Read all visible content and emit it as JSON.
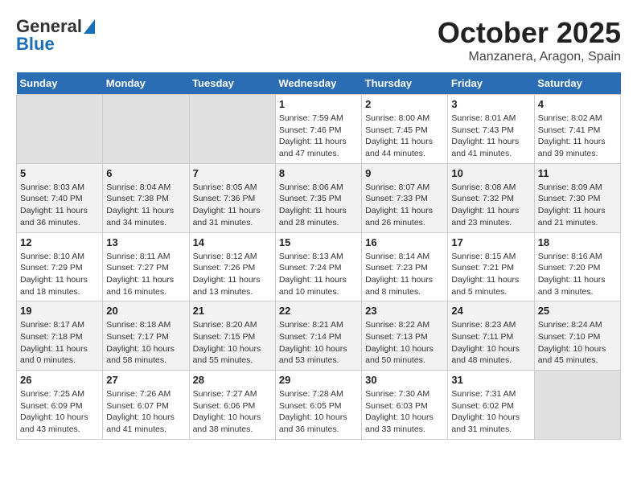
{
  "header": {
    "logo_general": "General",
    "logo_blue": "Blue",
    "month": "October 2025",
    "location": "Manzanera, Aragon, Spain"
  },
  "weekdays": [
    "Sunday",
    "Monday",
    "Tuesday",
    "Wednesday",
    "Thursday",
    "Friday",
    "Saturday"
  ],
  "weeks": [
    [
      {
        "day": "",
        "info": ""
      },
      {
        "day": "",
        "info": ""
      },
      {
        "day": "",
        "info": ""
      },
      {
        "day": "1",
        "info": "Sunrise: 7:59 AM\nSunset: 7:46 PM\nDaylight: 11 hours and 47 minutes."
      },
      {
        "day": "2",
        "info": "Sunrise: 8:00 AM\nSunset: 7:45 PM\nDaylight: 11 hours and 44 minutes."
      },
      {
        "day": "3",
        "info": "Sunrise: 8:01 AM\nSunset: 7:43 PM\nDaylight: 11 hours and 41 minutes."
      },
      {
        "day": "4",
        "info": "Sunrise: 8:02 AM\nSunset: 7:41 PM\nDaylight: 11 hours and 39 minutes."
      }
    ],
    [
      {
        "day": "5",
        "info": "Sunrise: 8:03 AM\nSunset: 7:40 PM\nDaylight: 11 hours and 36 minutes."
      },
      {
        "day": "6",
        "info": "Sunrise: 8:04 AM\nSunset: 7:38 PM\nDaylight: 11 hours and 34 minutes."
      },
      {
        "day": "7",
        "info": "Sunrise: 8:05 AM\nSunset: 7:36 PM\nDaylight: 11 hours and 31 minutes."
      },
      {
        "day": "8",
        "info": "Sunrise: 8:06 AM\nSunset: 7:35 PM\nDaylight: 11 hours and 28 minutes."
      },
      {
        "day": "9",
        "info": "Sunrise: 8:07 AM\nSunset: 7:33 PM\nDaylight: 11 hours and 26 minutes."
      },
      {
        "day": "10",
        "info": "Sunrise: 8:08 AM\nSunset: 7:32 PM\nDaylight: 11 hours and 23 minutes."
      },
      {
        "day": "11",
        "info": "Sunrise: 8:09 AM\nSunset: 7:30 PM\nDaylight: 11 hours and 21 minutes."
      }
    ],
    [
      {
        "day": "12",
        "info": "Sunrise: 8:10 AM\nSunset: 7:29 PM\nDaylight: 11 hours and 18 minutes."
      },
      {
        "day": "13",
        "info": "Sunrise: 8:11 AM\nSunset: 7:27 PM\nDaylight: 11 hours and 16 minutes."
      },
      {
        "day": "14",
        "info": "Sunrise: 8:12 AM\nSunset: 7:26 PM\nDaylight: 11 hours and 13 minutes."
      },
      {
        "day": "15",
        "info": "Sunrise: 8:13 AM\nSunset: 7:24 PM\nDaylight: 11 hours and 10 minutes."
      },
      {
        "day": "16",
        "info": "Sunrise: 8:14 AM\nSunset: 7:23 PM\nDaylight: 11 hours and 8 minutes."
      },
      {
        "day": "17",
        "info": "Sunrise: 8:15 AM\nSunset: 7:21 PM\nDaylight: 11 hours and 5 minutes."
      },
      {
        "day": "18",
        "info": "Sunrise: 8:16 AM\nSunset: 7:20 PM\nDaylight: 11 hours and 3 minutes."
      }
    ],
    [
      {
        "day": "19",
        "info": "Sunrise: 8:17 AM\nSunset: 7:18 PM\nDaylight: 11 hours and 0 minutes."
      },
      {
        "day": "20",
        "info": "Sunrise: 8:18 AM\nSunset: 7:17 PM\nDaylight: 10 hours and 58 minutes."
      },
      {
        "day": "21",
        "info": "Sunrise: 8:20 AM\nSunset: 7:15 PM\nDaylight: 10 hours and 55 minutes."
      },
      {
        "day": "22",
        "info": "Sunrise: 8:21 AM\nSunset: 7:14 PM\nDaylight: 10 hours and 53 minutes."
      },
      {
        "day": "23",
        "info": "Sunrise: 8:22 AM\nSunset: 7:13 PM\nDaylight: 10 hours and 50 minutes."
      },
      {
        "day": "24",
        "info": "Sunrise: 8:23 AM\nSunset: 7:11 PM\nDaylight: 10 hours and 48 minutes."
      },
      {
        "day": "25",
        "info": "Sunrise: 8:24 AM\nSunset: 7:10 PM\nDaylight: 10 hours and 45 minutes."
      }
    ],
    [
      {
        "day": "26",
        "info": "Sunrise: 7:25 AM\nSunset: 6:09 PM\nDaylight: 10 hours and 43 minutes."
      },
      {
        "day": "27",
        "info": "Sunrise: 7:26 AM\nSunset: 6:07 PM\nDaylight: 10 hours and 41 minutes."
      },
      {
        "day": "28",
        "info": "Sunrise: 7:27 AM\nSunset: 6:06 PM\nDaylight: 10 hours and 38 minutes."
      },
      {
        "day": "29",
        "info": "Sunrise: 7:28 AM\nSunset: 6:05 PM\nDaylight: 10 hours and 36 minutes."
      },
      {
        "day": "30",
        "info": "Sunrise: 7:30 AM\nSunset: 6:03 PM\nDaylight: 10 hours and 33 minutes."
      },
      {
        "day": "31",
        "info": "Sunrise: 7:31 AM\nSunset: 6:02 PM\nDaylight: 10 hours and 31 minutes."
      },
      {
        "day": "",
        "info": ""
      }
    ]
  ]
}
